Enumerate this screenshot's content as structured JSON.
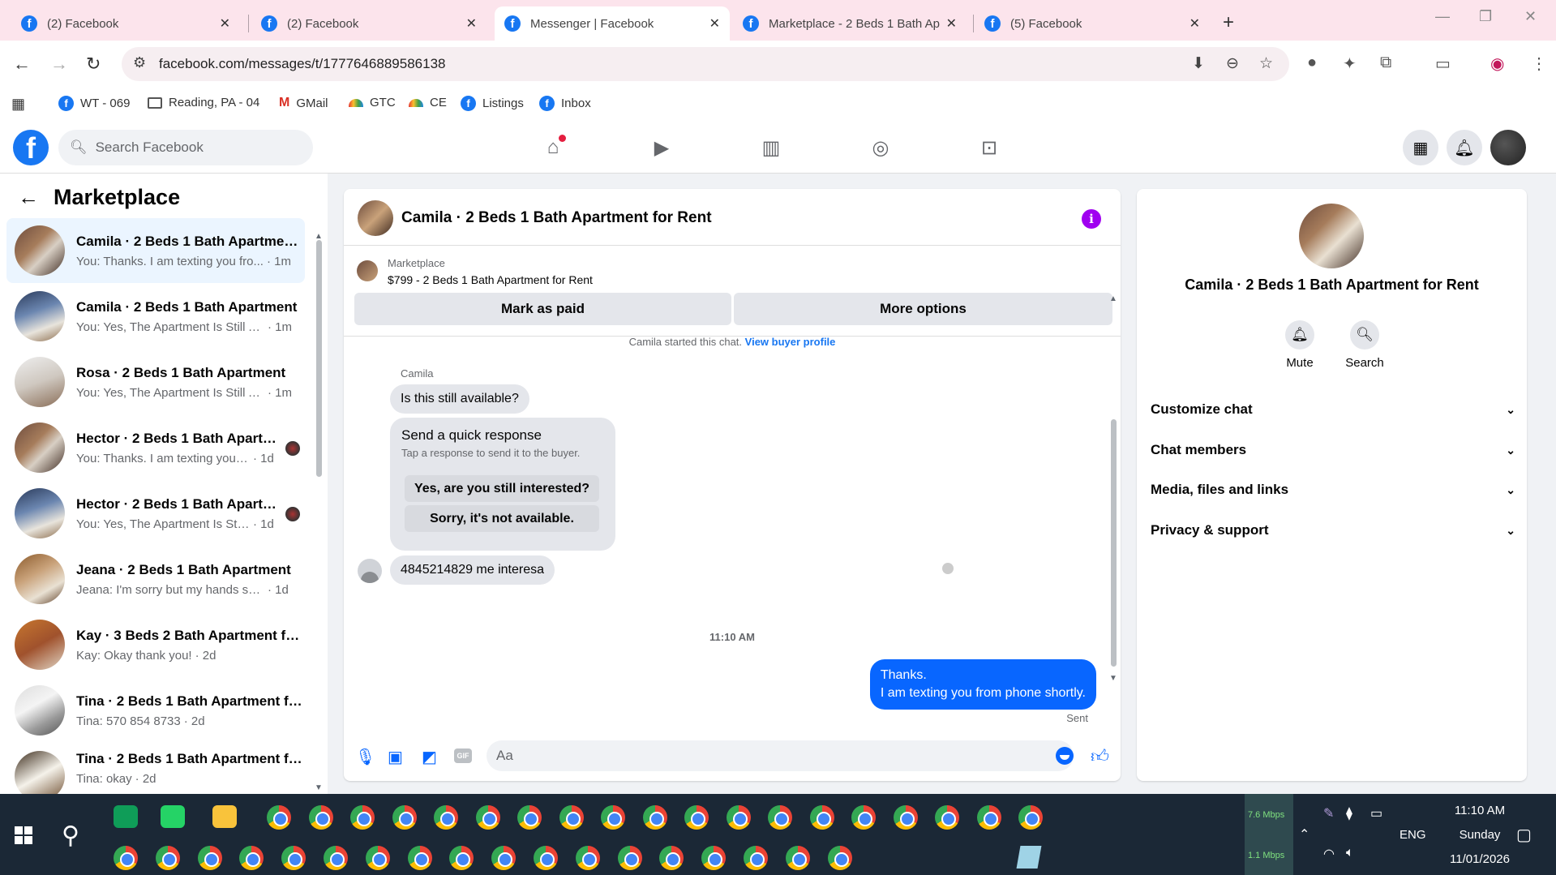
{
  "browser": {
    "tabs": [
      {
        "title": "(2) Facebook"
      },
      {
        "title": "(2) Facebook"
      },
      {
        "title": "Messenger | Facebook"
      },
      {
        "title": "Marketplace - 2 Beds 1 Bath Ap"
      },
      {
        "title": "(5) Facebook"
      }
    ],
    "url": "facebook.com/messages/t/1777646889586138",
    "bookmarks": [
      "WT - 069",
      "Reading, PA - 04",
      "GMail",
      "GTC",
      "CE",
      "Listings",
      "Inbox"
    ]
  },
  "fb": {
    "search_placeholder": "Search Facebook"
  },
  "sidebar": {
    "title": "Marketplace",
    "conversations": [
      {
        "name": "Camila · 2 Beds 1 Bath Apartment for Rent",
        "preview": "You: Thanks. I am texting you fro...",
        "time": "· 1m",
        "selected": true
      },
      {
        "name": "Camila · 2 Beds 1 Bath Apartment",
        "preview": "You: Yes, The Apartment Is Still Av...",
        "time": "· 1m"
      },
      {
        "name": "Rosa · 2 Beds 1 Bath Apartment",
        "preview": "You: Yes, The Apartment Is Still Av...",
        "time": "· 1m"
      },
      {
        "name": "Hector · 2 Beds 1 Bath Apartment",
        "preview": "You: Thanks. I am texting you fr...",
        "time": "· 1d"
      },
      {
        "name": "Hector · 2 Beds 1 Bath Apartment",
        "preview": "You: Yes, The Apartment Is Still ...",
        "time": "· 1d"
      },
      {
        "name": "Jeana · 2 Beds 1 Bath Apartment",
        "preview": "Jeana: I'm sorry but my hands shak...",
        "time": "· 1d"
      },
      {
        "name": "Kay · 3 Beds 2 Bath Apartment for Rent",
        "preview": "Kay: Okay thank you!",
        "time": "· 2d"
      },
      {
        "name": "Tina · 2 Beds 1 Bath Apartment for Rent",
        "preview": "Tina: 570 854 8733",
        "time": "· 2d"
      },
      {
        "name": "Tina · 2 Beds 1 Bath Apartment for Rent",
        "preview": "Tina: okay",
        "time": "· 2d"
      }
    ]
  },
  "chat": {
    "title": "Camila · 2 Beds 1 Bath Apartment for Rent",
    "listing_label": "Marketplace",
    "listing_detail": "$799 - 2 Beds 1 Bath Apartment for Rent",
    "mark_paid": "Mark as paid",
    "more_options": "More options",
    "started_text": "Camila started this chat.",
    "view_buyer": "View buyer profile",
    "sender_name": "Camila",
    "msg1": "Is this still available?",
    "quick_title": "Send a quick response",
    "quick_sub": "Tap a response to send it to the buyer.",
    "quick_yes": "Yes, are you still interested?",
    "quick_no": "Sorry, it's not available.",
    "msg2": "4845214829 me interesa",
    "timestamp": "11:10 AM",
    "mine_line1": "Thanks.",
    "mine_line2": "I am texting you from phone shortly.",
    "sent": "Sent",
    "composer_placeholder": "Aa",
    "gif": "GIF"
  },
  "info_panel": {
    "name": "Camila · 2 Beds 1 Bath Apartment for Rent",
    "mute": "Mute",
    "search": "Search",
    "sections": [
      "Customize chat",
      "Chat members",
      "Media, files and links",
      "Privacy & support"
    ]
  },
  "taskbar": {
    "net_down": "7.6 Mbps",
    "net_up": "1.1 Mbps",
    "lang": "ENG",
    "time": "11:10 AM",
    "day": "Sunday",
    "date": "11/01/2026"
  },
  "colors": {
    "fb_blue": "#1877f2",
    "messenger_blue": "#0866ff",
    "info_purple": "#a000f0"
  }
}
